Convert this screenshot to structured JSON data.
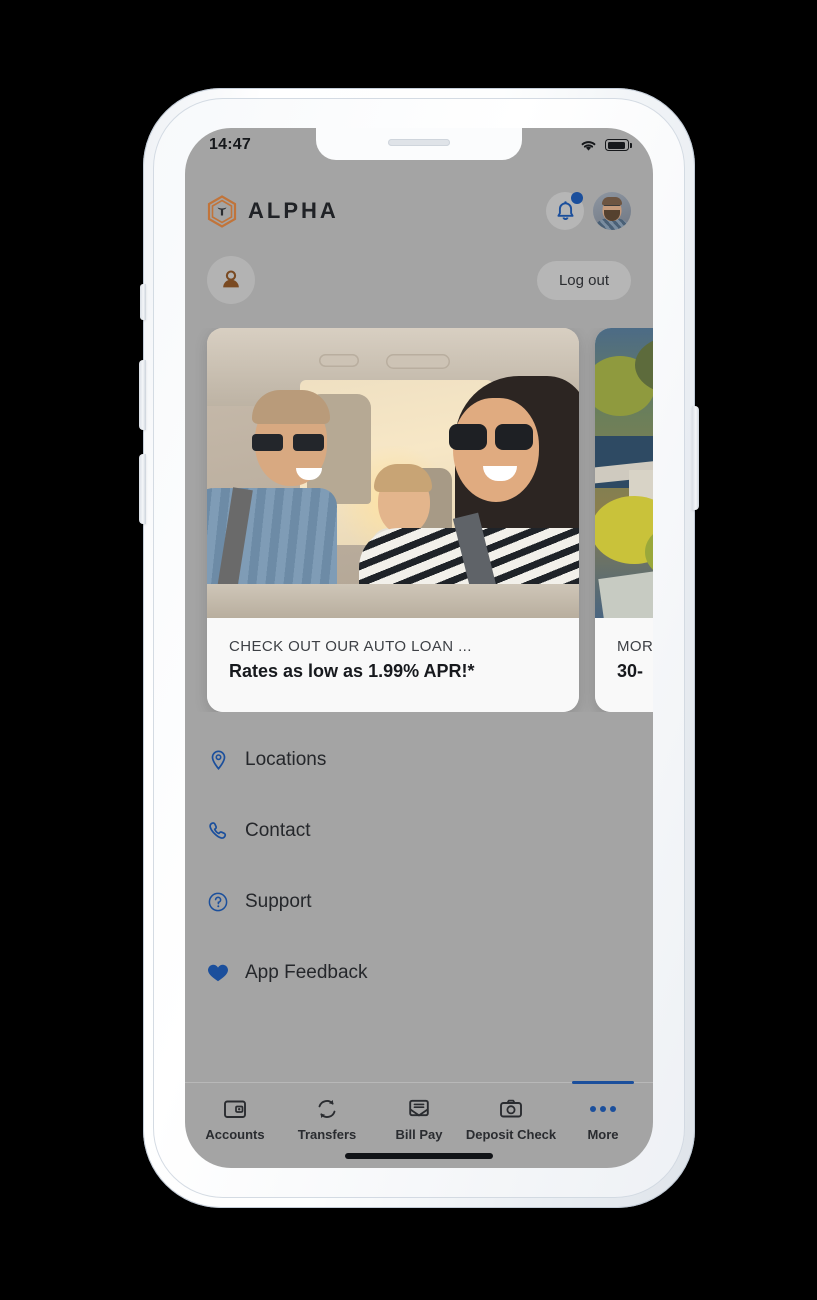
{
  "status_bar": {
    "time": "14:47",
    "wifi_icon": "wifi-icon",
    "battery_icon": "battery-full-icon"
  },
  "app_header": {
    "logo_icon": "alpha-hexagon-logo-icon",
    "brand_name": "ALPHA",
    "notification_icon": "bell-icon",
    "has_notification_badge": true,
    "avatar_icon": "user-avatar"
  },
  "user_row": {
    "profile_icon": "person-icon",
    "logout_label": "Log out"
  },
  "promos": [
    {
      "image": "family-in-car-photo",
      "kicker": "CHECK OUT OUR AUTO LOAN ...",
      "title": "Rates as low as 1.99% APR!*"
    },
    {
      "image": "aerial-neighborhood-photo",
      "kicker": "MOR",
      "title": "30-"
    }
  ],
  "menu": {
    "items": [
      {
        "label": "Locations",
        "icon": "map-pin-icon"
      },
      {
        "label": "Contact",
        "icon": "phone-icon"
      },
      {
        "label": "Support",
        "icon": "question-circle-icon"
      },
      {
        "label": "App Feedback",
        "icon": "heart-icon"
      }
    ]
  },
  "tabbar": {
    "tabs": [
      {
        "label": "Accounts",
        "icon": "wallet-icon",
        "active": false
      },
      {
        "label": "Transfers",
        "icon": "transfer-arrows-icon",
        "active": false
      },
      {
        "label": "Bill Pay",
        "icon": "envelope-icon",
        "active": false
      },
      {
        "label": "Deposit Check",
        "icon": "camera-icon",
        "active": false
      },
      {
        "label": "More",
        "icon": "ellipsis-icon",
        "active": true
      }
    ]
  },
  "colors": {
    "brand_orange": "#c1743a",
    "accent_blue": "#1b4f9c",
    "screen_dim": "#a4a4a4",
    "text_dark": "#202226"
  }
}
